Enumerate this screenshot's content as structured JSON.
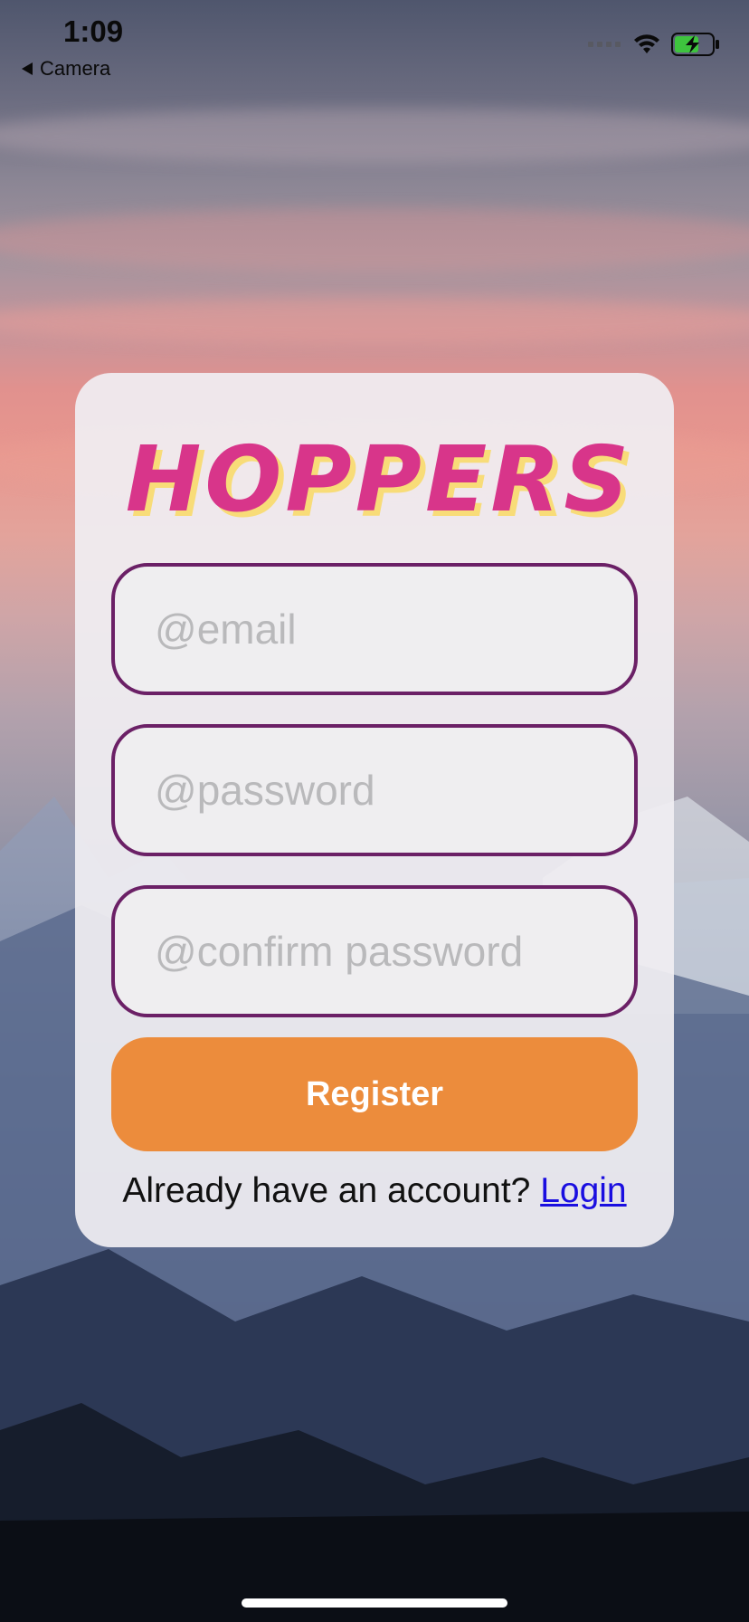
{
  "status_bar": {
    "time": "1:09",
    "back_label": "Camera"
  },
  "brand": {
    "logo_text": "HOPPERS",
    "logo_color": "#d8358a",
    "logo_shadow_color": "#f8dc78"
  },
  "form": {
    "email_placeholder": "@email",
    "password_placeholder": "@password",
    "confirm_placeholder": "@confirm password",
    "field_border_color": "#6b2066",
    "register_label": "Register",
    "register_color": "#ec8c3c",
    "login_prompt": "Already have an account? ",
    "login_link": "Login"
  },
  "icons": {
    "signal": "cellular-signal-icon",
    "wifi": "wifi-icon",
    "battery": "battery-charging-icon",
    "back": "back-arrow-icon"
  }
}
